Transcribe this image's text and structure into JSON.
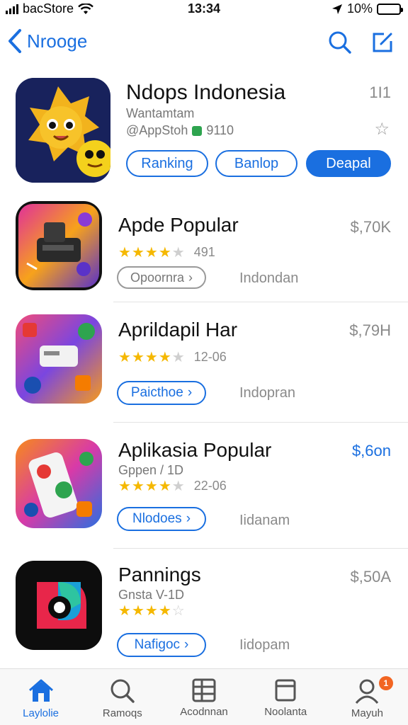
{
  "status_bar": {
    "carrier": "bacStore",
    "time": "13:34",
    "battery": "10%",
    "battery_level": 0.1
  },
  "nav": {
    "back_label": "Nrooge"
  },
  "featured": {
    "name": "Ndops Indonesia",
    "subtitle": "Wantamtam",
    "source": "@AppStoh",
    "source_badge": "9110",
    "corner_value": "1I1",
    "buttons": [
      "Ranking",
      "Banlop",
      "Deapal"
    ]
  },
  "apps": [
    {
      "name": "Apde Popular",
      "price": "$,70K",
      "price_color": "#8a8a8a",
      "rating": 4,
      "rating_count": "491",
      "button_label": "Opoornra",
      "region": "Indondan"
    },
    {
      "name": "Aprildapil Har",
      "price": "$,79H",
      "price_color": "#8a8a8a",
      "rating": 4,
      "rating_count": "12-06",
      "button_label": "Paicthoe",
      "region": "Indopran"
    },
    {
      "name": "Aplikasia Popular",
      "subtitle": "Gppen / 1D",
      "price": "$,6on",
      "price_color": "#1a6fe0",
      "rating": 4,
      "rating_count": "22-06",
      "button_label": "Nlodoes",
      "region": "Iidanam"
    },
    {
      "name": "Pannings",
      "subtitle": "Gnsta V-1D",
      "price": "$,50A",
      "price_color": "#8a8a8a",
      "rating": 4,
      "rating_count": "",
      "button_label": "Nafigoc",
      "region": "Iidopam"
    }
  ],
  "tabs": [
    {
      "label": "Laylolie",
      "icon": "home-icon",
      "active": true
    },
    {
      "label": "Ramoqs",
      "icon": "search-icon",
      "active": false
    },
    {
      "label": "Acodnnan",
      "icon": "grid-icon",
      "active": false
    },
    {
      "label": "Noolanta",
      "icon": "bookmark-icon",
      "active": false
    },
    {
      "label": "Mayuh",
      "icon": "profile-icon",
      "active": false,
      "badge": "1"
    }
  ],
  "colors": {
    "accent": "#1a6fe0",
    "star": "#f5b800",
    "badge": "#f26522"
  }
}
